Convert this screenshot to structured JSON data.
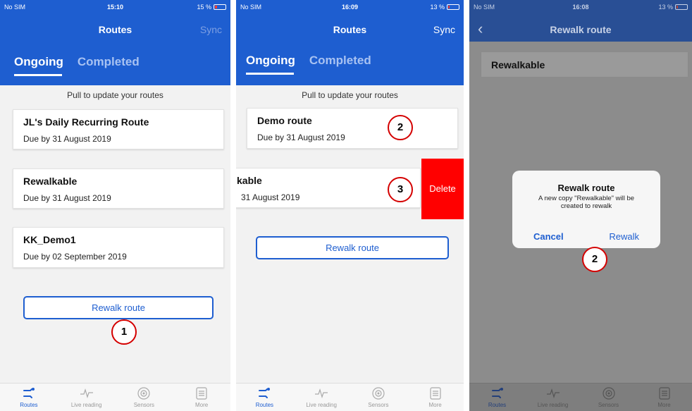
{
  "panel1": {
    "status": {
      "carrier": "No SIM",
      "time": "15:10",
      "battery": "15 %"
    },
    "title": "Routes",
    "sync": "Sync",
    "tabs": [
      "Ongoing",
      "Completed"
    ],
    "pull_text": "Pull to update your routes",
    "routes": [
      {
        "name": "JL's Daily Recurring Route",
        "due": "Due by 31 August 2019"
      },
      {
        "name": "Rewalkable",
        "due": "Due by 31 August 2019"
      },
      {
        "name": "KK_Demo1",
        "due": "Due by 02 September 2019"
      }
    ],
    "rewalk_button": "Rewalk route",
    "marker": "1"
  },
  "panel2": {
    "status": {
      "carrier": "No SIM",
      "time": "16:09",
      "battery": "13 %"
    },
    "title": "Routes",
    "sync": "Sync",
    "tabs": [
      "Ongoing",
      "Completed"
    ],
    "pull_text": "Pull to update your routes",
    "routes": [
      {
        "name": "Demo route",
        "due": "Due by 31 August 2019"
      },
      {
        "name": "kable",
        "due": "31 August 2019"
      }
    ],
    "delete_label": "Delete",
    "rewalk_button": "Rewalk route",
    "markers": [
      "2",
      "3"
    ]
  },
  "panel3": {
    "status": {
      "carrier": "No SIM",
      "time": "16:08",
      "battery": "13 %"
    },
    "title": "Rewalk route",
    "field_value": "Rewalkable",
    "dialog": {
      "title": "Rewalk route",
      "message": "A new copy \"Rewalkable\" will be created to rewalk",
      "cancel": "Cancel",
      "confirm": "Rewalk"
    },
    "marker": "2"
  },
  "tabbar": [
    "Routes",
    "Live reading",
    "Sensors",
    "More"
  ],
  "colors": {
    "header": "#1e5ed0",
    "delete": "#ff0000",
    "marker": "#d40000"
  }
}
